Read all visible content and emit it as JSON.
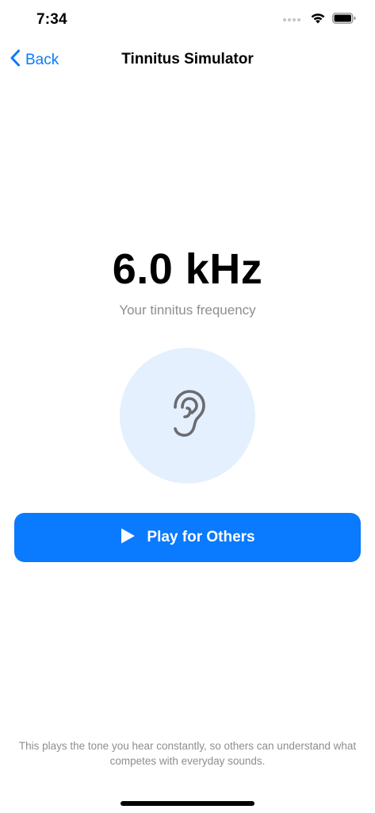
{
  "status_bar": {
    "time": "7:34"
  },
  "nav": {
    "back_label": "Back",
    "title": "Tinnitus Simulator"
  },
  "main": {
    "frequency_value": "6.0 kHz",
    "frequency_caption": "Your tinnitus frequency",
    "play_button_label": "Play for Others",
    "footer_note": "This plays the tone you hear constantly, so others can understand what competes with everyday sounds."
  },
  "icons": {
    "back": "chevron-left-icon",
    "ear": "ear-icon",
    "play": "play-icon",
    "wifi": "wifi-icon",
    "battery": "battery-icon"
  },
  "colors": {
    "accent": "#0a7aff",
    "ear_circle_bg": "#e4f0fd",
    "secondary_text": "#8e8e93"
  }
}
